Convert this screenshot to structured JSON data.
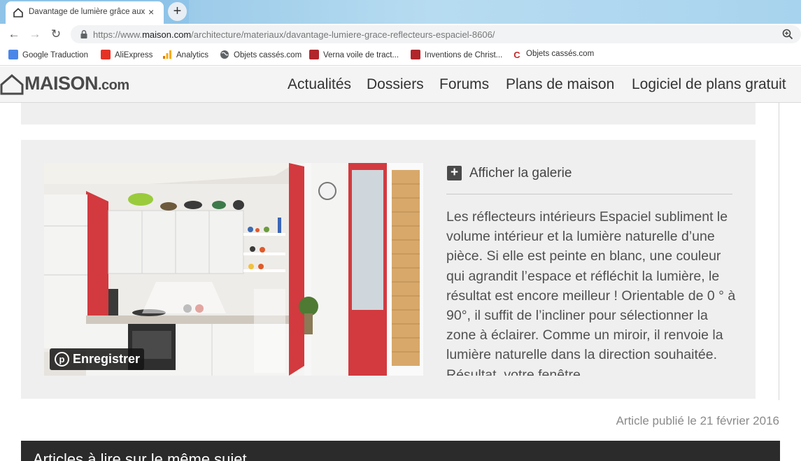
{
  "browser": {
    "tab_title": "Davantage de lumière grâce aux",
    "tab_close": "×",
    "new_tab": "+",
    "url_prefix": "https://www.",
    "url_host": "maison.com",
    "url_path": "/architecture/materiaux/davantage-lumiere-grace-reflecteurs-espaciel-8606/",
    "back": "←",
    "forward": "→",
    "reload": "↻"
  },
  "bookmarks": [
    {
      "label": "Google Traduction",
      "icon": "google-translate-icon",
      "color": "#4a86e8"
    },
    {
      "label": "AliExpress",
      "icon": "aliexpress-icon",
      "color": "#e43225"
    },
    {
      "label": "Analytics",
      "icon": "analytics-icon",
      "color": "#f9ab00"
    },
    {
      "label": "Objets cassés.com",
      "icon": "globe-icon",
      "color": "#5f6368"
    },
    {
      "label": "Verna voile de tract...",
      "icon": "site-icon",
      "color": "#b0262b"
    },
    {
      "label": "Inventions de Christ...",
      "icon": "site-icon",
      "color": "#b0262b"
    },
    {
      "label": "Objets cassés.com",
      "icon": "site-c-icon",
      "color": "#c62828"
    }
  ],
  "site": {
    "logo_main": "MAISON",
    "logo_suffix": ".com",
    "nav": [
      "Actualités",
      "Dossiers",
      "Forums",
      "Plans de maison",
      "Logiciel de plans gratuit"
    ]
  },
  "article": {
    "pin_label": "Enregistrer",
    "pin_glyph": "p",
    "gallery_label": "Afficher la galerie",
    "gallery_plus": "+",
    "description": "Les réflecteurs intérieurs Espaciel subliment le volume intérieur et la lumière naturelle d’une pièce. Si elle est peinte en blanc, une couleur qui agrandit l’espace et réfléchit la lumière, le résultat est encore meilleur ! Orientable de 0 ° à 90°, il suffit de l’incliner pour sélectionner la zone à éclairer. Comme un miroir, il renvoie la lumière naturelle dans la direction souhaitée. Résultat, votre fenêtre",
    "published": "Article publié le 21 février 2016",
    "related_title": "Articles à lire sur le même sujet"
  },
  "colors": {
    "tabstrip": "#8fc4e8",
    "header_bg": "#f4f4f4",
    "card_bg": "#efefef",
    "related_bg": "#2b2b2b",
    "kitchen_red": "#d23a3f"
  }
}
